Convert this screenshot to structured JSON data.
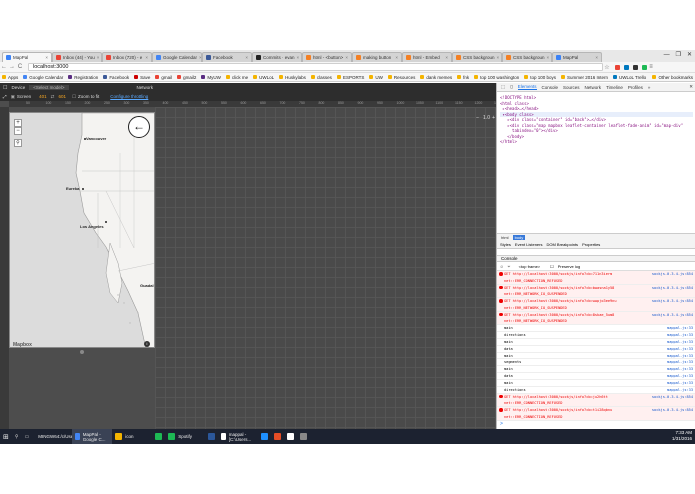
{
  "browser": {
    "tabs": [
      {
        "title": "MapPal",
        "color": "#3b82f6",
        "active": true
      },
      {
        "title": "Inbox (44) - You",
        "color": "#ea4335"
      },
      {
        "title": "Inbox (720) - e",
        "color": "#ea4335"
      },
      {
        "title": "Google Calendar",
        "color": "#4285f4"
      },
      {
        "title": "Facebook",
        "color": "#3b5998"
      },
      {
        "title": "Commits · evan",
        "color": "#222222"
      },
      {
        "title": "html - <button>",
        "color": "#f48024"
      },
      {
        "title": "making button",
        "color": "#f48024"
      },
      {
        "title": "html - Embed",
        "color": "#f48024"
      },
      {
        "title": "CSS backgroun",
        "color": "#f48024"
      },
      {
        "title": "CSS backgroun",
        "color": "#f48024"
      },
      {
        "title": "MapPal",
        "color": "#3b82f6"
      }
    ],
    "address": "localhost:3000",
    "nav": {
      "back": "←",
      "forward": "→",
      "reload": "C",
      "home": "⌂",
      "star": "☆",
      "menu": "≡"
    },
    "window_controls": {
      "minimize": "—",
      "maximize": "❐",
      "close": "✕"
    },
    "bookmarks": [
      {
        "label": "Apps",
        "color": "#f4b400"
      },
      {
        "label": "Google Calendar",
        "color": "#4285f4"
      },
      {
        "label": "Registration",
        "color": "#5a2d82"
      },
      {
        "label": "Facebook",
        "color": "#3b5998"
      },
      {
        "label": "Save",
        "color": "#c00"
      },
      {
        "label": "gmail",
        "color": "#ea4335"
      },
      {
        "label": "gmail2",
        "color": "#ea4335"
      },
      {
        "label": "MyUW",
        "color": "#5a2d82"
      },
      {
        "label": "click me",
        "color": "#f4b400"
      },
      {
        "label": "UWLoL",
        "color": "#f4b400"
      },
      {
        "label": "Huskylabs",
        "color": "#f4b400"
      },
      {
        "label": "classes",
        "color": "#f4b400"
      },
      {
        "label": "ESPORTS",
        "color": "#f4b400"
      },
      {
        "label": "UW",
        "color": "#f4b400"
      },
      {
        "label": "Resources",
        "color": "#f4b400"
      },
      {
        "label": "dank memes",
        "color": "#f4b400"
      },
      {
        "label": "fnk",
        "color": "#f4b400"
      },
      {
        "label": "top 100 washington",
        "color": "#f4b400"
      },
      {
        "label": "top 100 boys",
        "color": "#f4b400"
      },
      {
        "label": "Summer 2016 Intern",
        "color": "#f4b400"
      },
      {
        "label": "UWLoL Trello",
        "color": "#0079bf"
      },
      {
        "label": "Other bookmarks",
        "color": "#f4b400"
      }
    ]
  },
  "emulator": {
    "device_label": "Device",
    "device_select": "<Select model>",
    "network_label": "Network",
    "screen_label": "Screen",
    "width": "401",
    "height": "601",
    "zoom_label": "Zoom to fit",
    "throttling_link": "Configure throttling",
    "ruler_ticks": [
      "50",
      "100",
      "150",
      "200",
      "250",
      "300",
      "350",
      "400",
      "450",
      "500",
      "550",
      "600",
      "650",
      "700",
      "750",
      "800",
      "850",
      "900",
      "950",
      "1000",
      "1050",
      "1100",
      "1150",
      "1200",
      "1250"
    ],
    "scale": "1.0"
  },
  "map": {
    "zoom_in": "+",
    "zoom_out": "−",
    "search": "⚲",
    "back_arrow": "←",
    "cities": [
      "Vancouver",
      "Eureka",
      "Los Angeles",
      "Guadal"
    ],
    "attribution": "Mapbox",
    "info": "i"
  },
  "devtools": {
    "tabs": [
      "Elements",
      "Console",
      "Sources",
      "Network",
      "Timeline",
      "Profiles"
    ],
    "more": "»",
    "dom_lines": [
      "<!DOCTYPE html>",
      "<html class>",
      " ▸<head>…</head>",
      " ▾<body class>",
      "   ▸<div class=\"container\" id=\"back\">…</div>",
      "   ▸<div class=\"map mapbox leaflet-container leaflet-fade-anim\" id=\"map-div\"",
      "     tabindex=\"0\"></div>",
      "   </body>",
      "</html>"
    ],
    "breadcrumb": [
      "html",
      "body"
    ],
    "subtabs": [
      "Styles",
      "Event Listeners",
      "DOM Breakpoints",
      "Properties"
    ],
    "console_title": "Console",
    "filter": {
      "clear": "⊘",
      "filter": "⏷",
      "context": "<top frame>",
      "preserve": "Preserve log"
    },
    "log": [
      {
        "type": "err",
        "msg": "GET http://localhost:3000/sockjs/info?cb=711n3ierm",
        "sub": "net::ERR_CONNECTION_REFUSED",
        "src": "sockjs-0.3.4.js:854"
      },
      {
        "type": "err",
        "msg": "GET http://localhost:3000/sockjs/info?cb=bwasna1y58",
        "sub": "net::ERR_NETWORK_IO_SUSPENDED",
        "src": "sockjs-0.3.4.js:854"
      },
      {
        "type": "err",
        "msg": "GET http://localhost:3000/sockjs/info?cb=wwpjo3ee9nu",
        "sub": "net::ERR_NETWORK_IO_SUSPENDED",
        "src": "sockjs-0.3.4.js:854"
      },
      {
        "type": "err",
        "msg": "GET http://localhost:3000/sockjs/info?cb=8skae_5um8",
        "sub": "net::ERR_NETWORK_IO_SUSPENDED",
        "src": "sockjs-0.3.4.js:854"
      },
      {
        "type": "log",
        "msg": "main",
        "src": "mappal.js:33"
      },
      {
        "type": "log",
        "msg": "directions",
        "src": "mappal.js:33"
      },
      {
        "type": "log",
        "msg": "main",
        "src": "mappal.js:33"
      },
      {
        "type": "log",
        "msg": "data",
        "src": "mappal.js:33"
      },
      {
        "type": "log",
        "msg": "main",
        "src": "mappal.js:33"
      },
      {
        "type": "log",
        "msg": "segments",
        "src": "mappal.js:33"
      },
      {
        "type": "log",
        "msg": "main",
        "src": "mappal.js:33"
      },
      {
        "type": "log",
        "msg": "data",
        "src": "mappal.js:33"
      },
      {
        "type": "log",
        "msg": "main",
        "src": "mappal.js:33"
      },
      {
        "type": "log",
        "msg": "directions",
        "src": "mappal.js:33"
      },
      {
        "type": "err",
        "msg": "GET http://localhost:3000/sockjs/info?cb=ju2h6tt",
        "sub": "net::ERR_CONNECTION_REFUSED",
        "src": "sockjs-0.3.4.js:854"
      },
      {
        "type": "err",
        "msg": "GET http://localhost:3000/sockjs/info?cb=t1i28qbnu",
        "sub": "net::ERR_CONNECTION_REFUSED",
        "src": "sockjs-0.3.4.js:854"
      }
    ],
    "prompt": ">"
  },
  "taskbar": {
    "start": "⊞",
    "tasks": [
      {
        "label": "MINGW64:/c/Users...",
        "color": "#2d6b2d"
      },
      {
        "label": "MapPal - Google C...",
        "color": "#4285f4",
        "active": true
      },
      {
        "label": "icon",
        "color": "#f4b400"
      },
      {
        "label": "",
        "color": "#1db954"
      },
      {
        "label": "Spotify",
        "color": "#1db954"
      },
      {
        "label": "",
        "color": "#2b579a"
      },
      {
        "label": "mappal - [C:\\Users...",
        "color": "#fff"
      },
      {
        "label": "",
        "color": "#1e90ff"
      },
      {
        "label": "",
        "color": "#e44d26"
      },
      {
        "label": "",
        "color": "#fff"
      },
      {
        "label": "",
        "color": "#888"
      }
    ],
    "time": "7:33 AM",
    "date": "1/31/2016"
  }
}
